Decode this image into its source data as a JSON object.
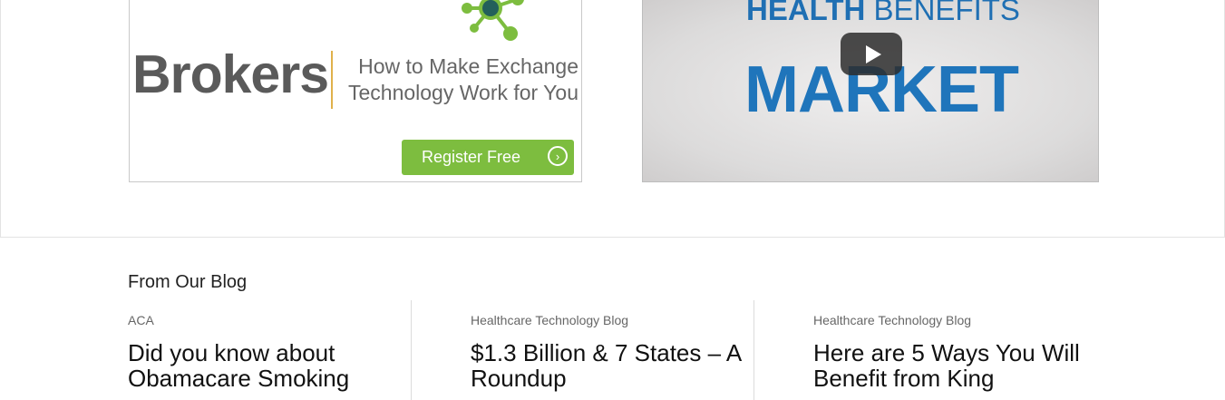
{
  "banner": {
    "brand": "Brokers",
    "tagline_line1": "How to Make Exchange",
    "tagline_line2": "Technology Work for You",
    "register_label": "Register Free",
    "accent_color": "#7dbd3f"
  },
  "video": {
    "subtitle_bold": "HEALTH",
    "subtitle_rest": " BENEFITS",
    "title": "MARKET",
    "play_icon": "play-icon"
  },
  "blog": {
    "heading": "From Our Blog",
    "posts": [
      {
        "category": "ACA",
        "title": "Did you know about Obamacare Smoking"
      },
      {
        "category": "Healthcare Technology Blog",
        "title": "$1.3 Billion & 7 States – A Roundup"
      },
      {
        "category": "Healthcare Technology Blog",
        "title": "Here are 5 Ways You Will Benefit from King"
      }
    ]
  }
}
